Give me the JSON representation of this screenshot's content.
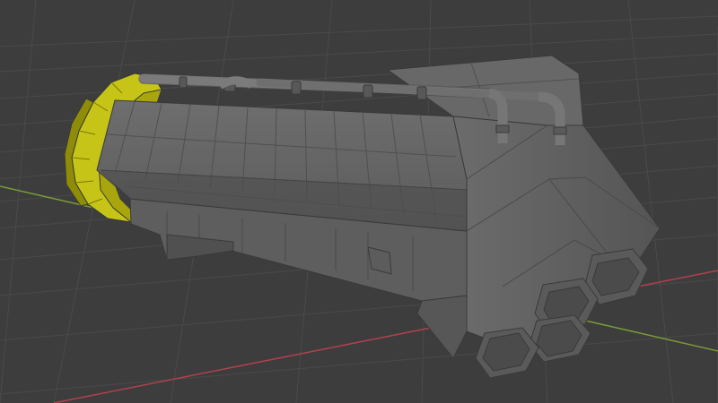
{
  "viewport": {
    "background": "#3d3d3d",
    "grid_visible": true,
    "grid_color": "#4a4a4a",
    "x_axis_color": "#b0414f",
    "y_axis_color": "#7a9a35"
  },
  "scene": {
    "active_object": "engine-block-mesh",
    "shading": "solid",
    "mesh_color": "#626262",
    "ring_color": "#b8b60c"
  }
}
